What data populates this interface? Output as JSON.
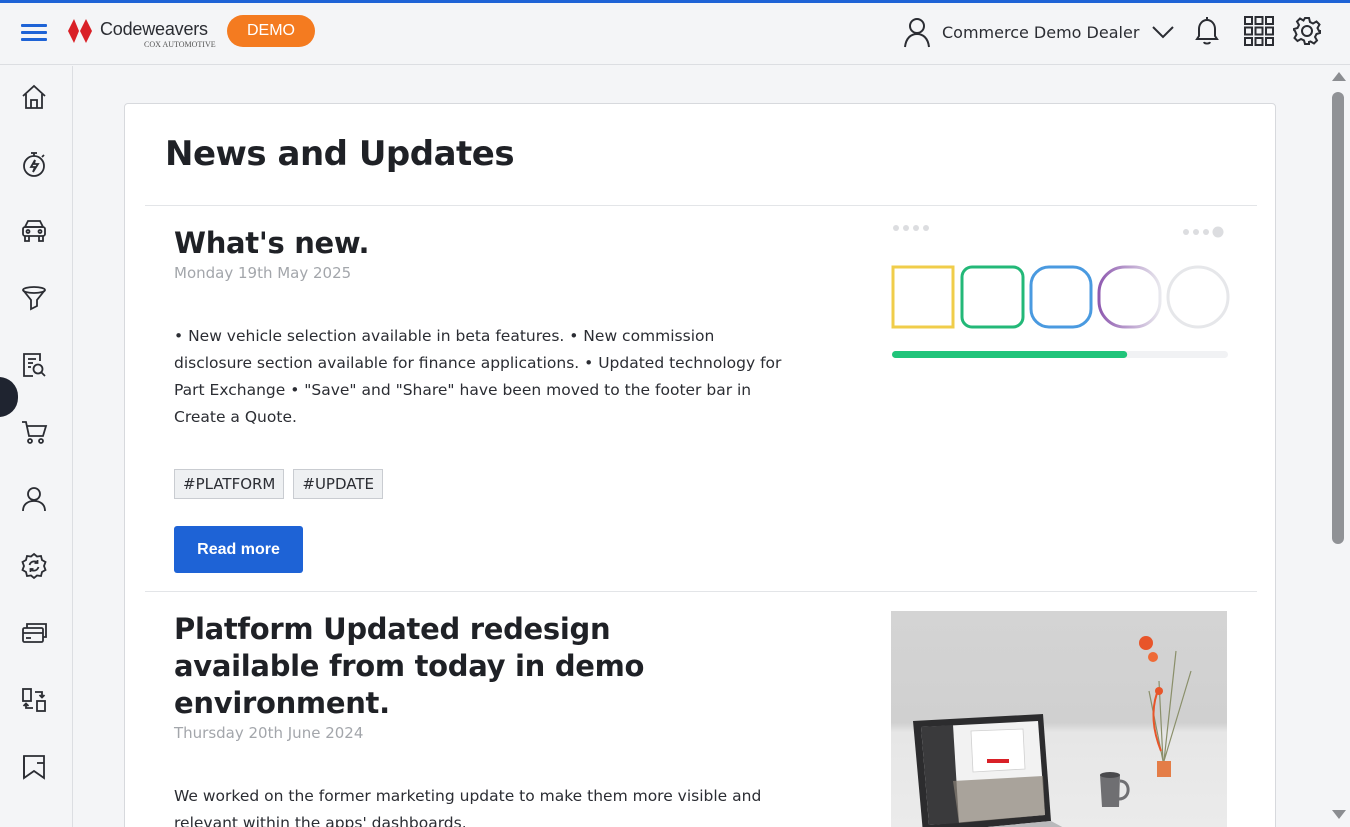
{
  "header": {
    "brand_name": "Codeweavers",
    "brand_sub": "COX AUTOMOTIVE",
    "demo_label": "DEMO",
    "user_name": "Commerce Demo Dealer",
    "icons": [
      "menu-icon",
      "user-icon",
      "chevron-down-icon",
      "bell-icon",
      "apps-grid-icon",
      "gear-icon"
    ]
  },
  "sidebar": {
    "items": [
      {
        "icon": "home-icon"
      },
      {
        "icon": "stopwatch-lightning-icon"
      },
      {
        "icon": "car-icon"
      },
      {
        "icon": "funnel-icon"
      },
      {
        "icon": "document-search-icon"
      },
      {
        "icon": "cart-icon"
      },
      {
        "icon": "users-icon"
      },
      {
        "icon": "sync-badge-icon"
      },
      {
        "icon": "cards-icon"
      },
      {
        "icon": "exchange-icon"
      },
      {
        "icon": "bookmark-icon"
      }
    ]
  },
  "main": {
    "title": "News and Updates",
    "articles": [
      {
        "title": "What's new.",
        "date": "Monday 19th May 2025",
        "body": "• New vehicle selection available in beta features. • New commission disclosure section available for finance applications. • Updated technology for Part Exchange • \"Save\" and \"Share\" have been moved to the footer bar in Create a Quote.",
        "tags": [
          "#PLATFORM",
          "#UPDATE"
        ],
        "cta": "Read more",
        "progress": 0.7
      },
      {
        "title": "Platform Updated redesign available from today in demo environment.",
        "date": "Thursday 20th June 2024",
        "body": "We worked on the former marketing update to make them more visible and relevant within the apps' dashboards."
      }
    ]
  },
  "colors": {
    "accent": "#1e63d6",
    "demo_badge": "#f47b20",
    "logo_red": "#d92027"
  }
}
